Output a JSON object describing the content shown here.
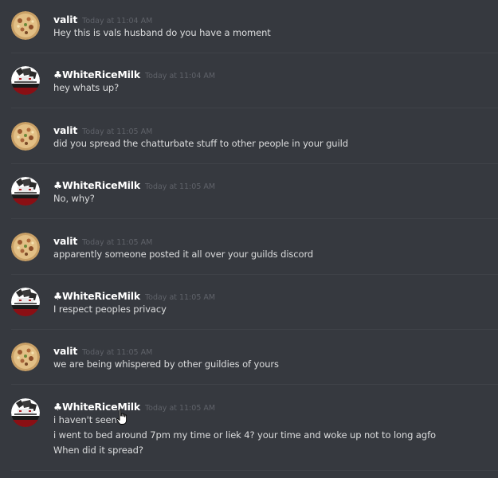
{
  "messages": [
    {
      "username": "valit",
      "timestamp": "Today at 11:04 AM",
      "avatar": "pizza-avatar",
      "lines": [
        "Hey this is vals husband do you have a moment"
      ]
    },
    {
      "username": "♣WhiteRiceMilk",
      "timestamp": "Today at 11:04 AM",
      "avatar": "anime-avatar",
      "lines": [
        "hey whats up?"
      ]
    },
    {
      "username": "valit",
      "timestamp": "Today at 11:05 AM",
      "avatar": "pizza-avatar",
      "lines": [
        "did you spread the chatturbate stuff to other people in your guild"
      ]
    },
    {
      "username": "♣WhiteRiceMilk",
      "timestamp": "Today at 11:05 AM",
      "avatar": "anime-avatar",
      "lines": [
        "No, why?"
      ]
    },
    {
      "username": "valit",
      "timestamp": "Today at 11:05 AM",
      "avatar": "pizza-avatar",
      "lines": [
        "apparently someone posted it all over your guilds discord"
      ]
    },
    {
      "username": "♣WhiteRiceMilk",
      "timestamp": "Today at 11:05 AM",
      "avatar": "anime-avatar",
      "lines": [
        "I respect peoples privacy"
      ]
    },
    {
      "username": "valit",
      "timestamp": "Today at 11:05 AM",
      "avatar": "pizza-avatar",
      "lines": [
        "we are being whispered by other guildies of yours"
      ]
    },
    {
      "username": "♣WhiteRiceMilk",
      "timestamp": "Today at 11:05 AM",
      "avatar": "anime-avatar",
      "lines": [
        "i haven't seen",
        "i went to bed around 7pm my time or liek 4? your time and woke up not to long agfo",
        "When did it spread?"
      ]
    }
  ],
  "colors": {
    "background": "#36393f",
    "username": "#ffffff",
    "timestamp": "#5f6269",
    "message_text": "#dcddde",
    "divider": "#3f4248"
  },
  "cursor": "hand-pointer-icon"
}
